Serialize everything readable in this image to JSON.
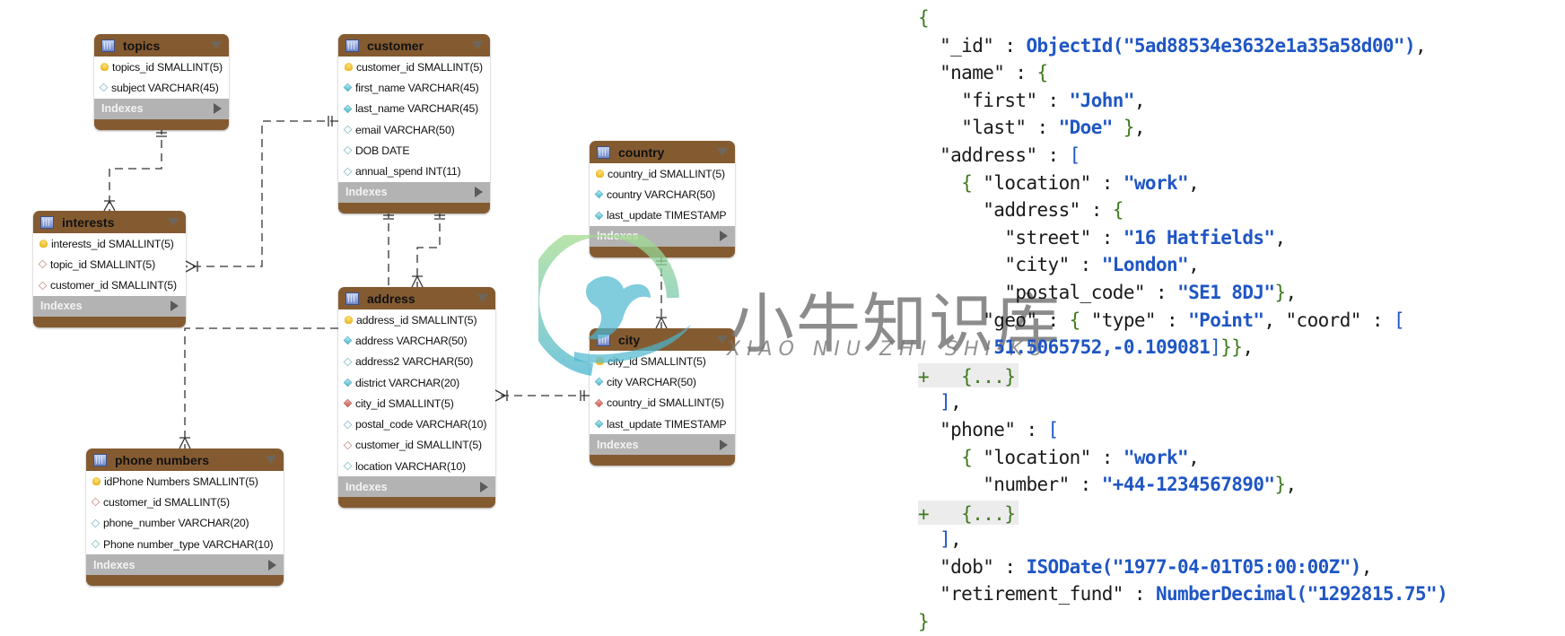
{
  "diagram": {
    "indexes_label": "Indexes",
    "tables": [
      {
        "id": "topics",
        "name": "topics",
        "columns": [
          {
            "kind": "key",
            "text": "topics_id SMALLINT(5)"
          },
          {
            "kind": "opt",
            "text": "subject VARCHAR(45)"
          }
        ]
      },
      {
        "id": "customer",
        "name": "customer",
        "columns": [
          {
            "kind": "key",
            "text": "customer_id SMALLINT(5)"
          },
          {
            "kind": "nn",
            "text": "first_name VARCHAR(45)"
          },
          {
            "kind": "nn",
            "text": "last_name VARCHAR(45)"
          },
          {
            "kind": "opt",
            "text": "email VARCHAR(50)"
          },
          {
            "kind": "opt",
            "text": "DOB DATE"
          },
          {
            "kind": "opt",
            "text": "annual_spend INT(11)"
          }
        ]
      },
      {
        "id": "interests",
        "name": "interests",
        "columns": [
          {
            "kind": "key",
            "text": "interests_id SMALLINT(5)"
          },
          {
            "kind": "fk",
            "text": "topic_id SMALLINT(5)"
          },
          {
            "kind": "fk",
            "text": "customer_id SMALLINT(5)"
          }
        ]
      },
      {
        "id": "country",
        "name": "country",
        "columns": [
          {
            "kind": "key",
            "text": "country_id SMALLINT(5)"
          },
          {
            "kind": "nn",
            "text": "country VARCHAR(50)"
          },
          {
            "kind": "nn",
            "text": "last_update TIMESTAMP"
          }
        ]
      },
      {
        "id": "address",
        "name": "address",
        "columns": [
          {
            "kind": "key",
            "text": "address_id SMALLINT(5)"
          },
          {
            "kind": "nn",
            "text": "address VARCHAR(50)"
          },
          {
            "kind": "opt",
            "text": "address2 VARCHAR(50)"
          },
          {
            "kind": "nn",
            "text": "district VARCHAR(20)"
          },
          {
            "kind": "fknn",
            "text": "city_id SMALLINT(5)"
          },
          {
            "kind": "opt",
            "text": "postal_code VARCHAR(10)"
          },
          {
            "kind": "fk",
            "text": "customer_id SMALLINT(5)"
          },
          {
            "kind": "opt",
            "text": "location VARCHAR(10)"
          }
        ]
      },
      {
        "id": "city",
        "name": "city",
        "columns": [
          {
            "kind": "key",
            "text": "city_id SMALLINT(5)"
          },
          {
            "kind": "nn",
            "text": "city VARCHAR(50)"
          },
          {
            "kind": "fknn",
            "text": "country_id SMALLINT(5)"
          },
          {
            "kind": "nn",
            "text": "last_update TIMESTAMP"
          }
        ]
      },
      {
        "id": "phone-numbers",
        "name": "phone numbers",
        "columns": [
          {
            "kind": "key",
            "text": "idPhone Numbers SMALLINT(5)"
          },
          {
            "kind": "fk",
            "text": "customer_id SMALLINT(5)"
          },
          {
            "kind": "opt",
            "text": "phone_number VARCHAR(20)"
          },
          {
            "kind": "opt",
            "text": "Phone number_type VARCHAR(10)"
          }
        ]
      }
    ],
    "relationships": [
      {
        "from": "topics",
        "to": "interests",
        "type": "one-to-many"
      },
      {
        "from": "customer",
        "to": "interests",
        "type": "one-to-many"
      },
      {
        "from": "customer",
        "to": "address",
        "type": "one-to-many"
      },
      {
        "from": "address",
        "to": "phone-numbers",
        "type": "one-to-many"
      },
      {
        "from": "city",
        "to": "address",
        "type": "one-to-many"
      },
      {
        "from": "country",
        "to": "city",
        "type": "one-to-many"
      }
    ]
  },
  "document": {
    "lines": [
      [
        {
          "c": "b",
          "t": "{"
        }
      ],
      [
        {
          "c": "p",
          "t": "  "
        },
        {
          "c": "k",
          "t": "\"_id\" : "
        },
        {
          "c": "f",
          "t": "ObjectId(\"5ad88534e3632e1a35a58d00\")"
        },
        {
          "c": "p",
          "t": ","
        }
      ],
      [
        {
          "c": "p",
          "t": "  "
        },
        {
          "c": "k",
          "t": "\"name\" : "
        },
        {
          "c": "b",
          "t": "{"
        }
      ],
      [
        {
          "c": "p",
          "t": "    "
        },
        {
          "c": "k",
          "t": "\"first\" : "
        },
        {
          "c": "s",
          "t": "\"John\""
        },
        {
          "c": "p",
          "t": ","
        }
      ],
      [
        {
          "c": "p",
          "t": "    "
        },
        {
          "c": "k",
          "t": "\"last\" : "
        },
        {
          "c": "s",
          "t": "\"Doe\""
        },
        {
          "c": "p",
          "t": " "
        },
        {
          "c": "b",
          "t": "}"
        },
        {
          "c": "p",
          "t": ","
        }
      ],
      [
        {
          "c": "p",
          "t": "  "
        },
        {
          "c": "k",
          "t": "\"address\" : "
        },
        {
          "c": "sq",
          "t": "["
        }
      ],
      [
        {
          "c": "p",
          "t": "    "
        },
        {
          "c": "b",
          "t": "{"
        },
        {
          "c": "k",
          "t": " \"location\" : "
        },
        {
          "c": "s",
          "t": "\"work\""
        },
        {
          "c": "p",
          "t": ","
        }
      ],
      [
        {
          "c": "p",
          "t": "      "
        },
        {
          "c": "k",
          "t": "\"address\" : "
        },
        {
          "c": "b",
          "t": "{"
        }
      ],
      [
        {
          "c": "p",
          "t": "        "
        },
        {
          "c": "k",
          "t": "\"street\" : "
        },
        {
          "c": "s",
          "t": "\"16 Hatfields\""
        },
        {
          "c": "p",
          "t": ","
        }
      ],
      [
        {
          "c": "p",
          "t": "        "
        },
        {
          "c": "k",
          "t": "\"city\" : "
        },
        {
          "c": "s",
          "t": "\"London\""
        },
        {
          "c": "p",
          "t": ","
        }
      ],
      [
        {
          "c": "p",
          "t": "        "
        },
        {
          "c": "k",
          "t": "\"postal_code\" : "
        },
        {
          "c": "s",
          "t": "\"SE1 8DJ\""
        },
        {
          "c": "b",
          "t": "}"
        },
        {
          "c": "p",
          "t": ","
        }
      ],
      [
        {
          "c": "p",
          "t": "      "
        },
        {
          "c": "k",
          "t": "\"geo\" : "
        },
        {
          "c": "b",
          "t": "{"
        },
        {
          "c": "k",
          "t": " \"type\" : "
        },
        {
          "c": "s",
          "t": "\"Point\""
        },
        {
          "c": "k",
          "t": ", \"coord\" : "
        },
        {
          "c": "sq",
          "t": "["
        }
      ],
      [
        {
          "c": "p",
          "t": "       "
        },
        {
          "c": "s",
          "t": "51.5065752,-0.109081"
        },
        {
          "c": "sq",
          "t": "]"
        },
        {
          "c": "b",
          "t": "}}"
        },
        {
          "c": "p",
          "t": ","
        }
      ],
      [
        {
          "c": "collapsed",
          "t": "+   {...}"
        }
      ],
      [
        {
          "c": "p",
          "t": "  "
        },
        {
          "c": "sq",
          "t": "]"
        },
        {
          "c": "p",
          "t": ","
        }
      ],
      [
        {
          "c": "p",
          "t": "  "
        },
        {
          "c": "k",
          "t": "\"phone\" : "
        },
        {
          "c": "sq",
          "t": "["
        }
      ],
      [
        {
          "c": "p",
          "t": "    "
        },
        {
          "c": "b",
          "t": "{"
        },
        {
          "c": "k",
          "t": " \"location\" : "
        },
        {
          "c": "s",
          "t": "\"work\""
        },
        {
          "c": "p",
          "t": ","
        }
      ],
      [
        {
          "c": "p",
          "t": "      "
        },
        {
          "c": "k",
          "t": "\"number\" : "
        },
        {
          "c": "s",
          "t": "\"+44-1234567890\""
        },
        {
          "c": "b",
          "t": "}"
        },
        {
          "c": "p",
          "t": ","
        }
      ],
      [
        {
          "c": "collapsed",
          "t": "+   {...}"
        }
      ],
      [
        {
          "c": "p",
          "t": "  "
        },
        {
          "c": "sq",
          "t": "]"
        },
        {
          "c": "p",
          "t": ","
        }
      ],
      [
        {
          "c": "p",
          "t": "  "
        },
        {
          "c": "k",
          "t": "\"dob\" : "
        },
        {
          "c": "f",
          "t": "ISODate(\"1977-04-01T05:00:00Z\")"
        },
        {
          "c": "p",
          "t": ","
        }
      ],
      [
        {
          "c": "p",
          "t": "  "
        },
        {
          "c": "k",
          "t": "\"retirement_fund\" : "
        },
        {
          "c": "f",
          "t": "NumberDecimal(\"1292815.75\")"
        }
      ],
      [
        {
          "c": "b",
          "t": "}"
        }
      ]
    ]
  },
  "watermark": {
    "chinese": "小牛知识库",
    "pinyin": "XIAO NIU ZHI SHI KU"
  }
}
